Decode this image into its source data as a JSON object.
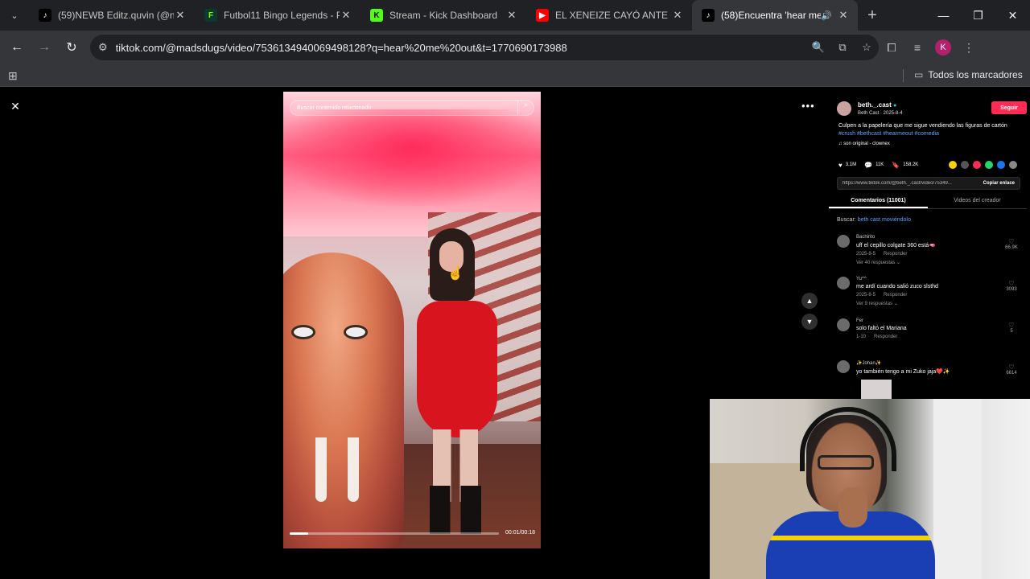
{
  "browser": {
    "tabs": [
      {
        "title": "(59)NEWB Editz.quvin (@ne",
        "icon": "tiktok-icon"
      },
      {
        "title": "Futbol11 Bingo Legends - Pl",
        "icon": "futbol11-icon"
      },
      {
        "title": "Stream - Kick Dashboard",
        "icon": "kick-icon"
      },
      {
        "title": "EL XENEIZE CAYÓ ANTE EL P",
        "icon": "youtube-icon"
      },
      {
        "title": "(58)Encuentra 'hear me o",
        "icon": "tiktok-icon"
      }
    ],
    "url": "tiktok.com/@madsdugs/video/7536134940069498128?q=hear%20me%20out&t=1770690173988",
    "profile_initial": "K",
    "bookmarks_folder": "Todos los marcadores"
  },
  "player": {
    "search_placeholder": "Buscar contenido relacionado",
    "time": "00:01/00:18",
    "progress": 0.09
  },
  "post": {
    "handle": "beth._.cast",
    "author_line": "Beth Cast · 2025-8-4",
    "follow_label": "Seguir",
    "description": "Culpen a la papelería que me sigue vendiendo las figuras de cartón",
    "hashtags": "#crush #bethcast #hearmeout #comedia",
    "music": "♫ son original - clownex",
    "likes": "3.1M",
    "comments_count": "11K",
    "saves": "158.2K",
    "link": "https://www.tiktok.com/@beth._.cast/video/75349...",
    "copy_link_label": "Copiar enlace",
    "tab_comments": "Comentarios (11001)",
    "tab_creator": "Videos del creador",
    "search_prefix": "Buscar:",
    "search_query": "beth cast moviéndolo"
  },
  "comments": [
    {
      "name": "Bachirito",
      "text": "uff el cepillo colgate 360 está🫦",
      "date": "2025-8-5",
      "reply": "Responder",
      "replies": "Ver 40 respuestas ⌄",
      "likes": "66.9K"
    },
    {
      "name": "Yu^^",
      "text": "me ardí cuando salió zuco slsthd",
      "date": "2025-8-5",
      "reply": "Responder",
      "replies": "Ver 9 respuestas ⌄",
      "likes": "3093"
    },
    {
      "name": "Fer",
      "text": "solo faltó el Mariana",
      "date": "1-10",
      "reply": "Responder",
      "replies": "",
      "likes": "5"
    },
    {
      "name": "✨Johan✨",
      "text": "yo también tengo a mi Zuko jaja❤️✨",
      "date": "",
      "reply": "",
      "replies": "",
      "likes": "6614"
    }
  ],
  "colors": {
    "follow": "#fe2c55",
    "hashtag": "#58a6ff",
    "tab_bg": "#202124",
    "toolbar_bg": "#35363a"
  }
}
